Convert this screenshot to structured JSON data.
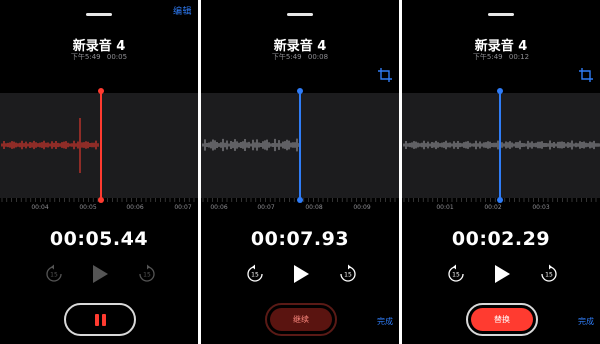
{
  "colors": {
    "accent_blue": "#2f7cf6",
    "record_red": "#ff3b30",
    "background": "#000000",
    "waveform_gray": "#8e8e93"
  },
  "icons": {
    "crop": "crop-icon",
    "skip_back": "skip-back-15-icon",
    "skip_forward": "skip-forward-15-icon",
    "play": "play-icon",
    "pause": "pause-icon"
  },
  "panels": [
    {
      "edit_label": "编辑",
      "title": "新录音 4",
      "meta_time": "下午5:49",
      "meta_duration": "00:05",
      "timer": "00:05.44",
      "ruler_labels": [
        "00:04",
        "00:05",
        "00:06",
        "00:07"
      ],
      "skip_back_label": "15",
      "skip_forward_label": "15",
      "record_button_label": "",
      "done_label": ""
    },
    {
      "edit_label": "",
      "title": "新录音 4",
      "meta_time": "下午5:49",
      "meta_duration": "00:08",
      "timer": "00:07.93",
      "ruler_labels": [
        "00:06",
        "00:07",
        "00:08",
        "00:09"
      ],
      "skip_back_label": "15",
      "skip_forward_label": "15",
      "record_button_label": "继续",
      "done_label": "完成"
    },
    {
      "edit_label": "",
      "title": "新录音 4",
      "meta_time": "下午5:49",
      "meta_duration": "00:12",
      "timer": "00:02.29",
      "ruler_labels": [
        "00:01",
        "00:02",
        "00:03"
      ],
      "skip_back_label": "15",
      "skip_forward_label": "15",
      "record_button_label": "替换",
      "done_label": "完成"
    }
  ]
}
